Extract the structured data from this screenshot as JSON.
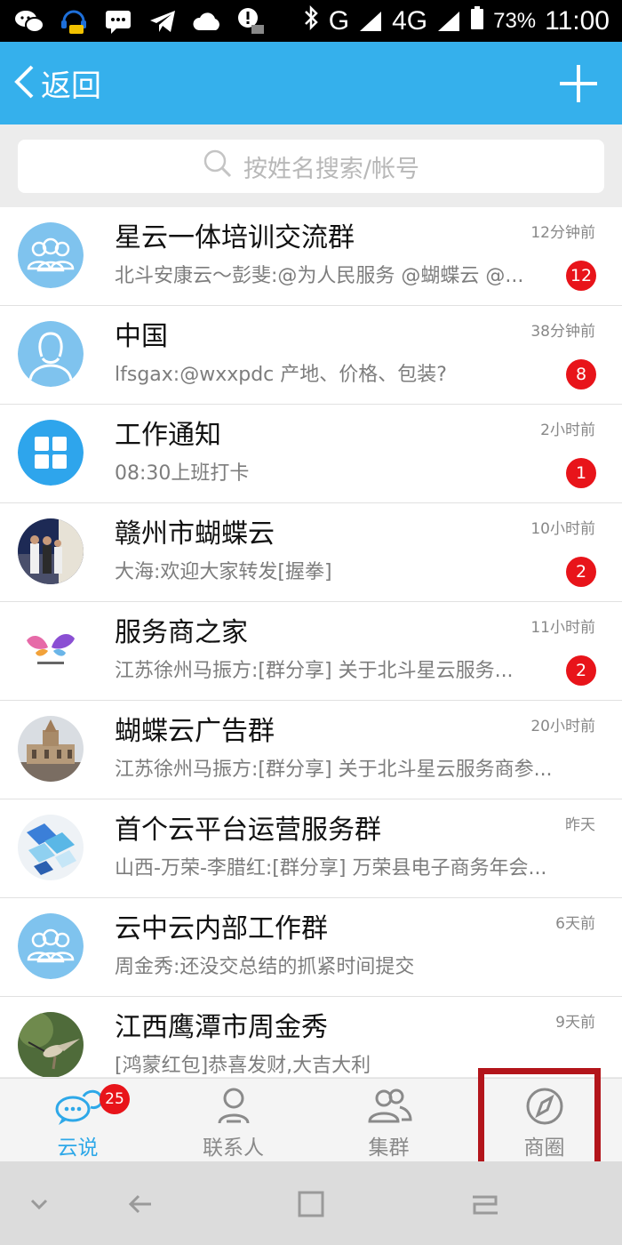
{
  "status_bar": {
    "network_g": "G",
    "network_4g": "4G",
    "battery": "73%",
    "time": "11:00",
    "icons": [
      "wechat-icon",
      "headset-chat-icon",
      "message-icon",
      "telegram-icon",
      "cloud-icon",
      "alert-icon",
      "bluetooth-icon",
      "signal-icon",
      "battery-icon"
    ]
  },
  "header": {
    "back_label": "返回",
    "accent_color": "#35b0ec"
  },
  "search": {
    "placeholder": "按姓名搜索/帐号"
  },
  "chats": [
    {
      "name": "星云一体培训交流群",
      "time": "12分钟前",
      "preview": "北斗安康云～彭斐:@为人民服务 @蝴蝶云 @...",
      "badge": "12",
      "avatar": "group-avatar-icon"
    },
    {
      "name": "中国",
      "time": "38分钟前",
      "preview": "lfsgax:@wxxpdc 产地、价格、包装?",
      "badge": "8",
      "avatar": "person-avatar-icon"
    },
    {
      "name": "工作通知",
      "time": "2小时前",
      "preview": "08:30上班打卡",
      "badge": "1",
      "avatar": "app-grid-icon"
    },
    {
      "name": "赣州市蝴蝶云",
      "time": "10小时前",
      "preview": "大海:欢迎大家转发[握拳]",
      "badge": "2",
      "avatar": "photo-avatar"
    },
    {
      "name": "服务商之家",
      "time": "11小时前",
      "preview": "江苏徐州马振方:[群分享] 关于北斗星云服务...",
      "badge": "2",
      "avatar": "butterfly-logo"
    },
    {
      "name": "蝴蝶云广告群",
      "time": "20小时前",
      "preview": "江苏徐州马振方:[群分享] 关于北斗星云服务商参...",
      "badge": "",
      "avatar": "building-photo-avatar"
    },
    {
      "name": "首个云平台运营服务群",
      "time": "昨天",
      "preview": "山西-万荣-李腊红:[群分享] 万荣县电子商务年会...",
      "badge": "",
      "avatar": "cloud-platform-avatar"
    },
    {
      "name": "云中云内部工作群",
      "time": "6天前",
      "preview": "周金秀:还没交总结的抓紧时间提交",
      "badge": "",
      "avatar": "group-avatar-icon"
    },
    {
      "name": "江西鹰潭市周金秀",
      "time": "9天前",
      "preview": "[鸿蒙红包]恭喜发财,大吉大利",
      "badge": "",
      "avatar": "hummingbird-photo-avatar"
    }
  ],
  "tabs": [
    {
      "label": "云说",
      "badge": "25",
      "active": true,
      "icon": "chat-bubbles-icon"
    },
    {
      "label": "联系人",
      "active": false,
      "icon": "contact-icon"
    },
    {
      "label": "集群",
      "active": false,
      "icon": "group-icon"
    },
    {
      "label": "商圈",
      "active": false,
      "icon": "compass-icon"
    }
  ],
  "highlight_color": "#b3151b"
}
